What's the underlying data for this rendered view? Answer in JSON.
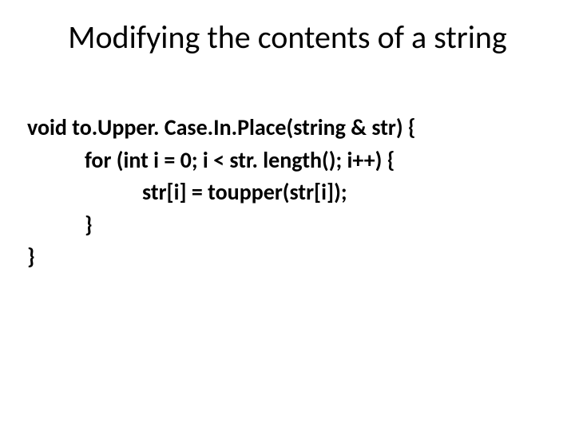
{
  "slide": {
    "title": "Modifying the contents of a string",
    "code": {
      "l1": "void to.Upper. Case.In.Place(string & str) {",
      "l2": "for (int i = 0; i < str. length(); i++) {",
      "l3": "str[i] = toupper(str[i]);",
      "l4": "}",
      "l5": "}"
    }
  }
}
